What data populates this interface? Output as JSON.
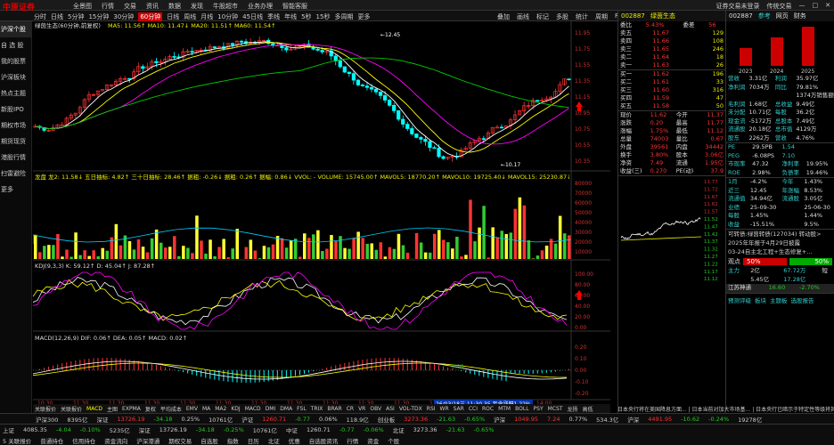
{
  "top": {
    "logo": "中原证券",
    "menu": [
      "全景图",
      "行情",
      "交易",
      "资讯",
      "数据",
      "发现",
      "牛股超市",
      "业务办理",
      "智能客服"
    ],
    "right": [
      "证券交易未登录",
      "传统交易",
      "",
      "",
      "",
      "",
      ""
    ]
  },
  "toolbar": {
    "periods": [
      "分时",
      "日线",
      "5分钟",
      "15分钟",
      "30分钟",
      "60分钟",
      "日线",
      "周线",
      "月线",
      "10分钟",
      "45日线",
      "季线",
      "年线",
      "5秒",
      "15秒",
      "多周期",
      "更多"
    ],
    "selected": "60分钟",
    "tools": [
      "叠加",
      "画线",
      "标记",
      "多股",
      "统计",
      "周期",
      "F10",
      "标记"
    ]
  },
  "sidebar": [
    "沪深个股",
    "自 选 股",
    "我的股票",
    "沪深板块",
    "热点主题",
    "新股IPO",
    "期权市场",
    "期货现货",
    "港股行情",
    "扫雷避险",
    "更多"
  ],
  "sidebar_active": "沪深个股",
  "chart": {
    "title": "绿茵生态(60分钟,前复权)",
    "ma_line": "MA5: 11.56↑  MA10: 11.47↓  MA20: 11.51↑  MA60: 11.54↑",
    "high_label": "12.45",
    "low_label": "10.17",
    "price_axis": [
      "11.95",
      "11.75",
      "11.55",
      "11.35",
      "11.15",
      "10.95",
      "10.75",
      "10.55",
      "10.35"
    ],
    "vol_line": "龙盘  龙2: 11.58↓  五日抽标: 4.82↑  三十日抽标: 28.46↑  据粗: -0.26↓  据粗: 0.26↑  据幅: 0.86↓  VVOL: - VOLUME: 15745.00↑  MAVOL5: 18770.20↑  MAVOL10: 19725.40↓  MAVOL15: 25230.87↓",
    "vol_axis": [
      "80000",
      "70000",
      "60000",
      "50000",
      "40000",
      "30000",
      "20000",
      "10000"
    ],
    "kdj_line": "KDJ(9,3,3)  K: 59.12↑  D: 45.04↑  J: 87.28↑",
    "kdj_axis": [
      "100.00",
      "80.00",
      "60.00",
      "40.00",
      "20.00",
      "0.00"
    ],
    "macd_line": "MACD(12,26,9)  DIF: 0.06↑  DEA: 0.05↑  MACD: 0.02↑",
    "macd_axis": [
      "0.20",
      "0.10",
      "0.00",
      "-0.10",
      "-0.20"
    ],
    "macd_zero": "0.00",
    "time_labels": [
      "10:30",
      "11:30",
      "11:30",
      "11:30",
      "11:30",
      "11:30",
      "11:30",
      "11:30",
      "11:30",
      "11:30",
      "11:30",
      "11:30",
      "11:30",
      "11:30",
      "14:00"
    ],
    "cursor_label": "26/03/18三 11:30 35 至今涨幅1.22%",
    "period_label": "60分钟"
  },
  "indicator_tabs": [
    "关联报价",
    "关联报价",
    "MACD",
    "主图",
    "EXPMA",
    "复权",
    "平均成本",
    "EMV",
    "MA",
    "MA2",
    "KDJ",
    "MACD",
    "DMI",
    "DMA",
    "FSL",
    "TRIX",
    "BRAR",
    "CR",
    "VR",
    "OBV",
    "ASI",
    "VOL-TDX",
    "RSI",
    "WR",
    "SAR",
    "CCI",
    "ROC",
    "MTM",
    "BOLL",
    "PSY",
    "MCST",
    "龙扬",
    "高低"
  ],
  "quote": {
    "code": "002887",
    "name": "绿茵生态",
    "webi_label": "委比",
    "webi": "5.43%",
    "weicha_label": "委差",
    "weicha": "56",
    "sells": [
      [
        "卖五",
        "11.67",
        "129"
      ],
      [
        "卖四",
        "11.66",
        "108"
      ],
      [
        "卖三",
        "11.65",
        "246"
      ],
      [
        "卖二",
        "11.64",
        "18"
      ],
      [
        "卖一",
        "11.63",
        "26"
      ]
    ],
    "buys": [
      [
        "买一",
        "11.62",
        "196"
      ],
      [
        "买二",
        "11.61",
        "33"
      ],
      [
        "买三",
        "11.60",
        "316"
      ],
      [
        "买四",
        "11.59",
        "47"
      ],
      [
        "买五",
        "11.58",
        "50"
      ]
    ],
    "stats": [
      [
        "现价",
        "11.62",
        "今开",
        "11.37"
      ],
      [
        "涨跌",
        "0.20",
        "最高",
        "11.77"
      ],
      [
        "涨幅",
        "1.75%",
        "最低",
        "11.12"
      ],
      [
        "总量",
        "74003",
        "量比",
        "0.67"
      ],
      [
        "外盘",
        "39561",
        "内盘",
        "34442"
      ],
      [
        "换手",
        "3.80%",
        "股本",
        "3.06亿"
      ],
      [
        "净资",
        "7.49",
        "流通",
        "1.95亿"
      ],
      [
        "收益(三)",
        "0.270",
        "PE(动)",
        "37.9"
      ]
    ],
    "mini_axis": [
      "11.77",
      "11.72",
      "11.67",
      "11.62",
      "11.57",
      "11.52",
      "11.47",
      "11.42",
      "11.37",
      "11.32",
      "11.27",
      "11.22",
      "11.17",
      "11.12"
    ]
  },
  "f10": {
    "code": "002887",
    "name": "绿茵生态",
    "tabs": [
      "参考",
      "网页",
      "财务"
    ],
    "years": [
      "2023",
      "2024",
      "2025"
    ],
    "fin": [
      [
        "营收",
        "3.31亿",
        "利润",
        "35.97亿"
      ],
      [
        "净利润",
        "7034万",
        "同比",
        "79.81%"
      ],
      [
        "",
        "",
        " ",
        "1374万销售额"
      ],
      [
        "毛利润",
        "1.68亿",
        "总收益",
        "9.49亿"
      ],
      [
        "未分配",
        "10.71亿",
        "每股",
        "36.2亿"
      ],
      [
        "现金流",
        "-5172万",
        "总股本",
        "7.49亿"
      ],
      [
        "流通股",
        "20.18亿",
        "总市值",
        "4129万"
      ],
      [
        "股东",
        "2262万",
        "营收",
        "4.76%"
      ]
    ],
    "valuation": [
      [
        "PE",
        "29.5PB",
        "1.54"
      ],
      [
        "PEG",
        "-6.08PS",
        "7.10"
      ],
      [
        "市现率",
        "47.32",
        "净利率",
        "19.95%"
      ],
      [
        "ROE",
        "2.98%",
        "负债率",
        "19.46%"
      ]
    ],
    "returns": [
      [
        "1月",
        "-4.2%",
        "今年",
        "1.43%"
      ],
      [
        "近三",
        "12.45",
        "年涨幅",
        "8.53%"
      ],
      [
        "流通值",
        "34.94亿",
        "流通股",
        "3.05亿"
      ],
      [
        "业绩",
        "25-09-30",
        "",
        "25-06-30"
      ],
      [
        "每股",
        "1.45%",
        "",
        "1.44%"
      ],
      [
        "收益",
        "-15.51%",
        "",
        "9.5%"
      ]
    ],
    "news": [
      "可转债:绿茵转债(127034) 转动股>",
      "2025年年报于4月29日披露",
      "03-24自主北工程+生态修复+...",
      "",
      "",
      "",
      ""
    ],
    "vote": {
      "label": "观点",
      "pct_up": "50%",
      "pct_down": "50%",
      "up_count": "1人",
      "down_count": "1人"
    },
    "flows": [
      [
        "主力",
        "2亿",
        "67.72万",
        "短"
      ],
      [
        "",
        "5.45亿",
        "17.28亿",
        ""
      ]
    ],
    "board": [
      [
        "江苏神通",
        "16.60",
        "-2.70%"
      ]
    ],
    "bottom_tabs": [
      "预测评级",
      "板块",
      "主题板",
      "选股报告"
    ]
  },
  "status": [
    "沪深300",
    "8395亿",
    "深证",
    "13726.19",
    "-34.18",
    "0.25%",
    "10761亿",
    "沪证",
    "1260.71",
    "-0.77",
    "0.06%",
    "118.9亿",
    "创业板",
    "3273.36",
    "-21.63",
    "-0.65%",
    "沪深",
    "1049.95",
    "7.24",
    "0.77%",
    "534.3亿",
    "沪深",
    "4491.95",
    "-10.62",
    "-0.24%",
    "19278亿"
  ],
  "news_ticker": "日本央行将在美国降息方面... | 日本当前对加大市场基... | 日本央行已暗示于特定性等级将其合拍",
  "bottom": {
    "row1": [
      "上证",
      "4085.35",
      "-4.04",
      "-0.10%",
      "5235亿",
      "深证",
      "13726.19",
      "-34.18",
      "-0.25%",
      "10761亿",
      "中证",
      "1260.71",
      "-0.77",
      "-0.06%",
      "北证",
      "3273.36",
      "-21.63",
      "-0.65%"
    ],
    "row2": [
      "5 关联报价",
      "普通持仓",
      "信用持仓",
      "资金流向",
      "沪深港通",
      "期权交易",
      "自选股",
      "指数",
      "日历",
      "北证",
      "优惠",
      "自选股资讯",
      "行情",
      "资金",
      "个股"
    ]
  },
  "colors": {
    "up": "#ff3333",
    "down": "#22cc22",
    "ma5": "#ffffff",
    "ma10": "#ffff00",
    "ma20": "#ff00ff",
    "ma60": "#00cc00",
    "bg": "#000000"
  }
}
